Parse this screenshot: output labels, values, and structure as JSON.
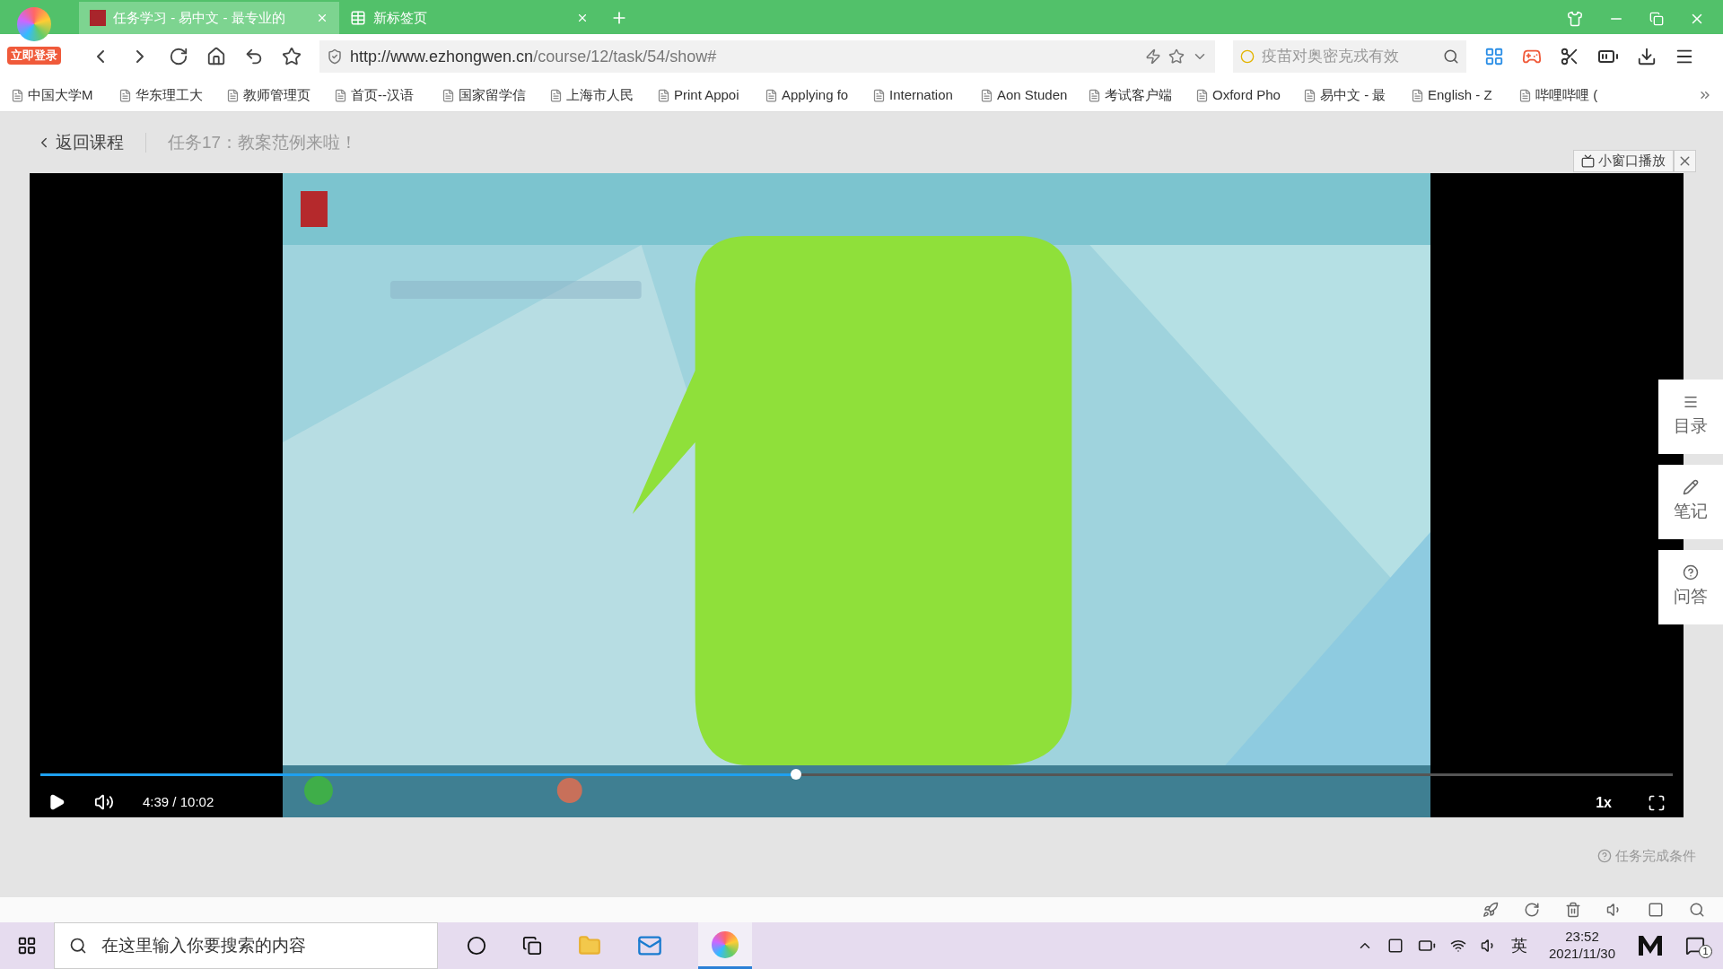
{
  "browser": {
    "login_badge": "立即登录",
    "tabs": [
      {
        "title": "任务学习 - 易中文 - 最专业的",
        "selected": true
      },
      {
        "title": "新标签页",
        "selected": false
      }
    ],
    "url": {
      "host": "http://www.ezhongwen.cn",
      "path": "/course/12/task/54/show#"
    },
    "search": {
      "placeholder": "疫苗对奥密克戎有效"
    },
    "bookmarks": [
      "中国大学M",
      "华东理工大",
      "教师管理页",
      "首页--汉语",
      "国家留学信",
      "上海市人民",
      "Print Appoi",
      "Applying fo",
      "Internation",
      "Aon Studen",
      "考试客户端",
      "Oxford Pho",
      "易中文 - 最",
      "English - Z",
      "哔哩哔哩 ("
    ]
  },
  "page": {
    "back": "返回课程",
    "task_title": "任务17：教案范例来啦！",
    "mini_player": "小窗口播放",
    "video": {
      "playing": false,
      "time": "4:39 / 10:02",
      "speed": "1x",
      "progress": {
        "level": 0.463
      }
    },
    "side_tools": [
      "目录",
      "笔记",
      "问答"
    ],
    "completion": "任务完成条件"
  },
  "taskbar": {
    "search_placeholder": "在这里输入你要搜索的内容",
    "ime": "英",
    "time": "23:52",
    "date": "2021/11/30",
    "notifications": "1"
  }
}
